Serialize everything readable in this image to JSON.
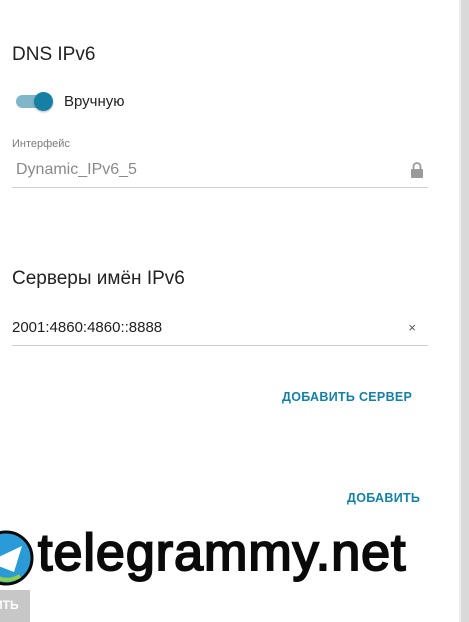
{
  "dns": {
    "title": "DNS IPv6",
    "mode_label": "Вручную",
    "mode_on": true,
    "interface_label": "Интерфейс",
    "interface_value": "Dynamic_IPv6_5"
  },
  "servers": {
    "title": "Серверы имён IPv6",
    "items": [
      "2001:4860:4860::8888"
    ],
    "clear_symbol": "×",
    "add_server_label": "ДОБАВИТЬ СЕРВЕР"
  },
  "footer": {
    "add_label": "ДОБАВИТЬ",
    "bottom_button_label": "ИТЬ"
  },
  "watermark": {
    "text": "telegrammy.net"
  },
  "colors": {
    "accent": "#1680a4",
    "toggle_track": "#7fb7c9"
  }
}
